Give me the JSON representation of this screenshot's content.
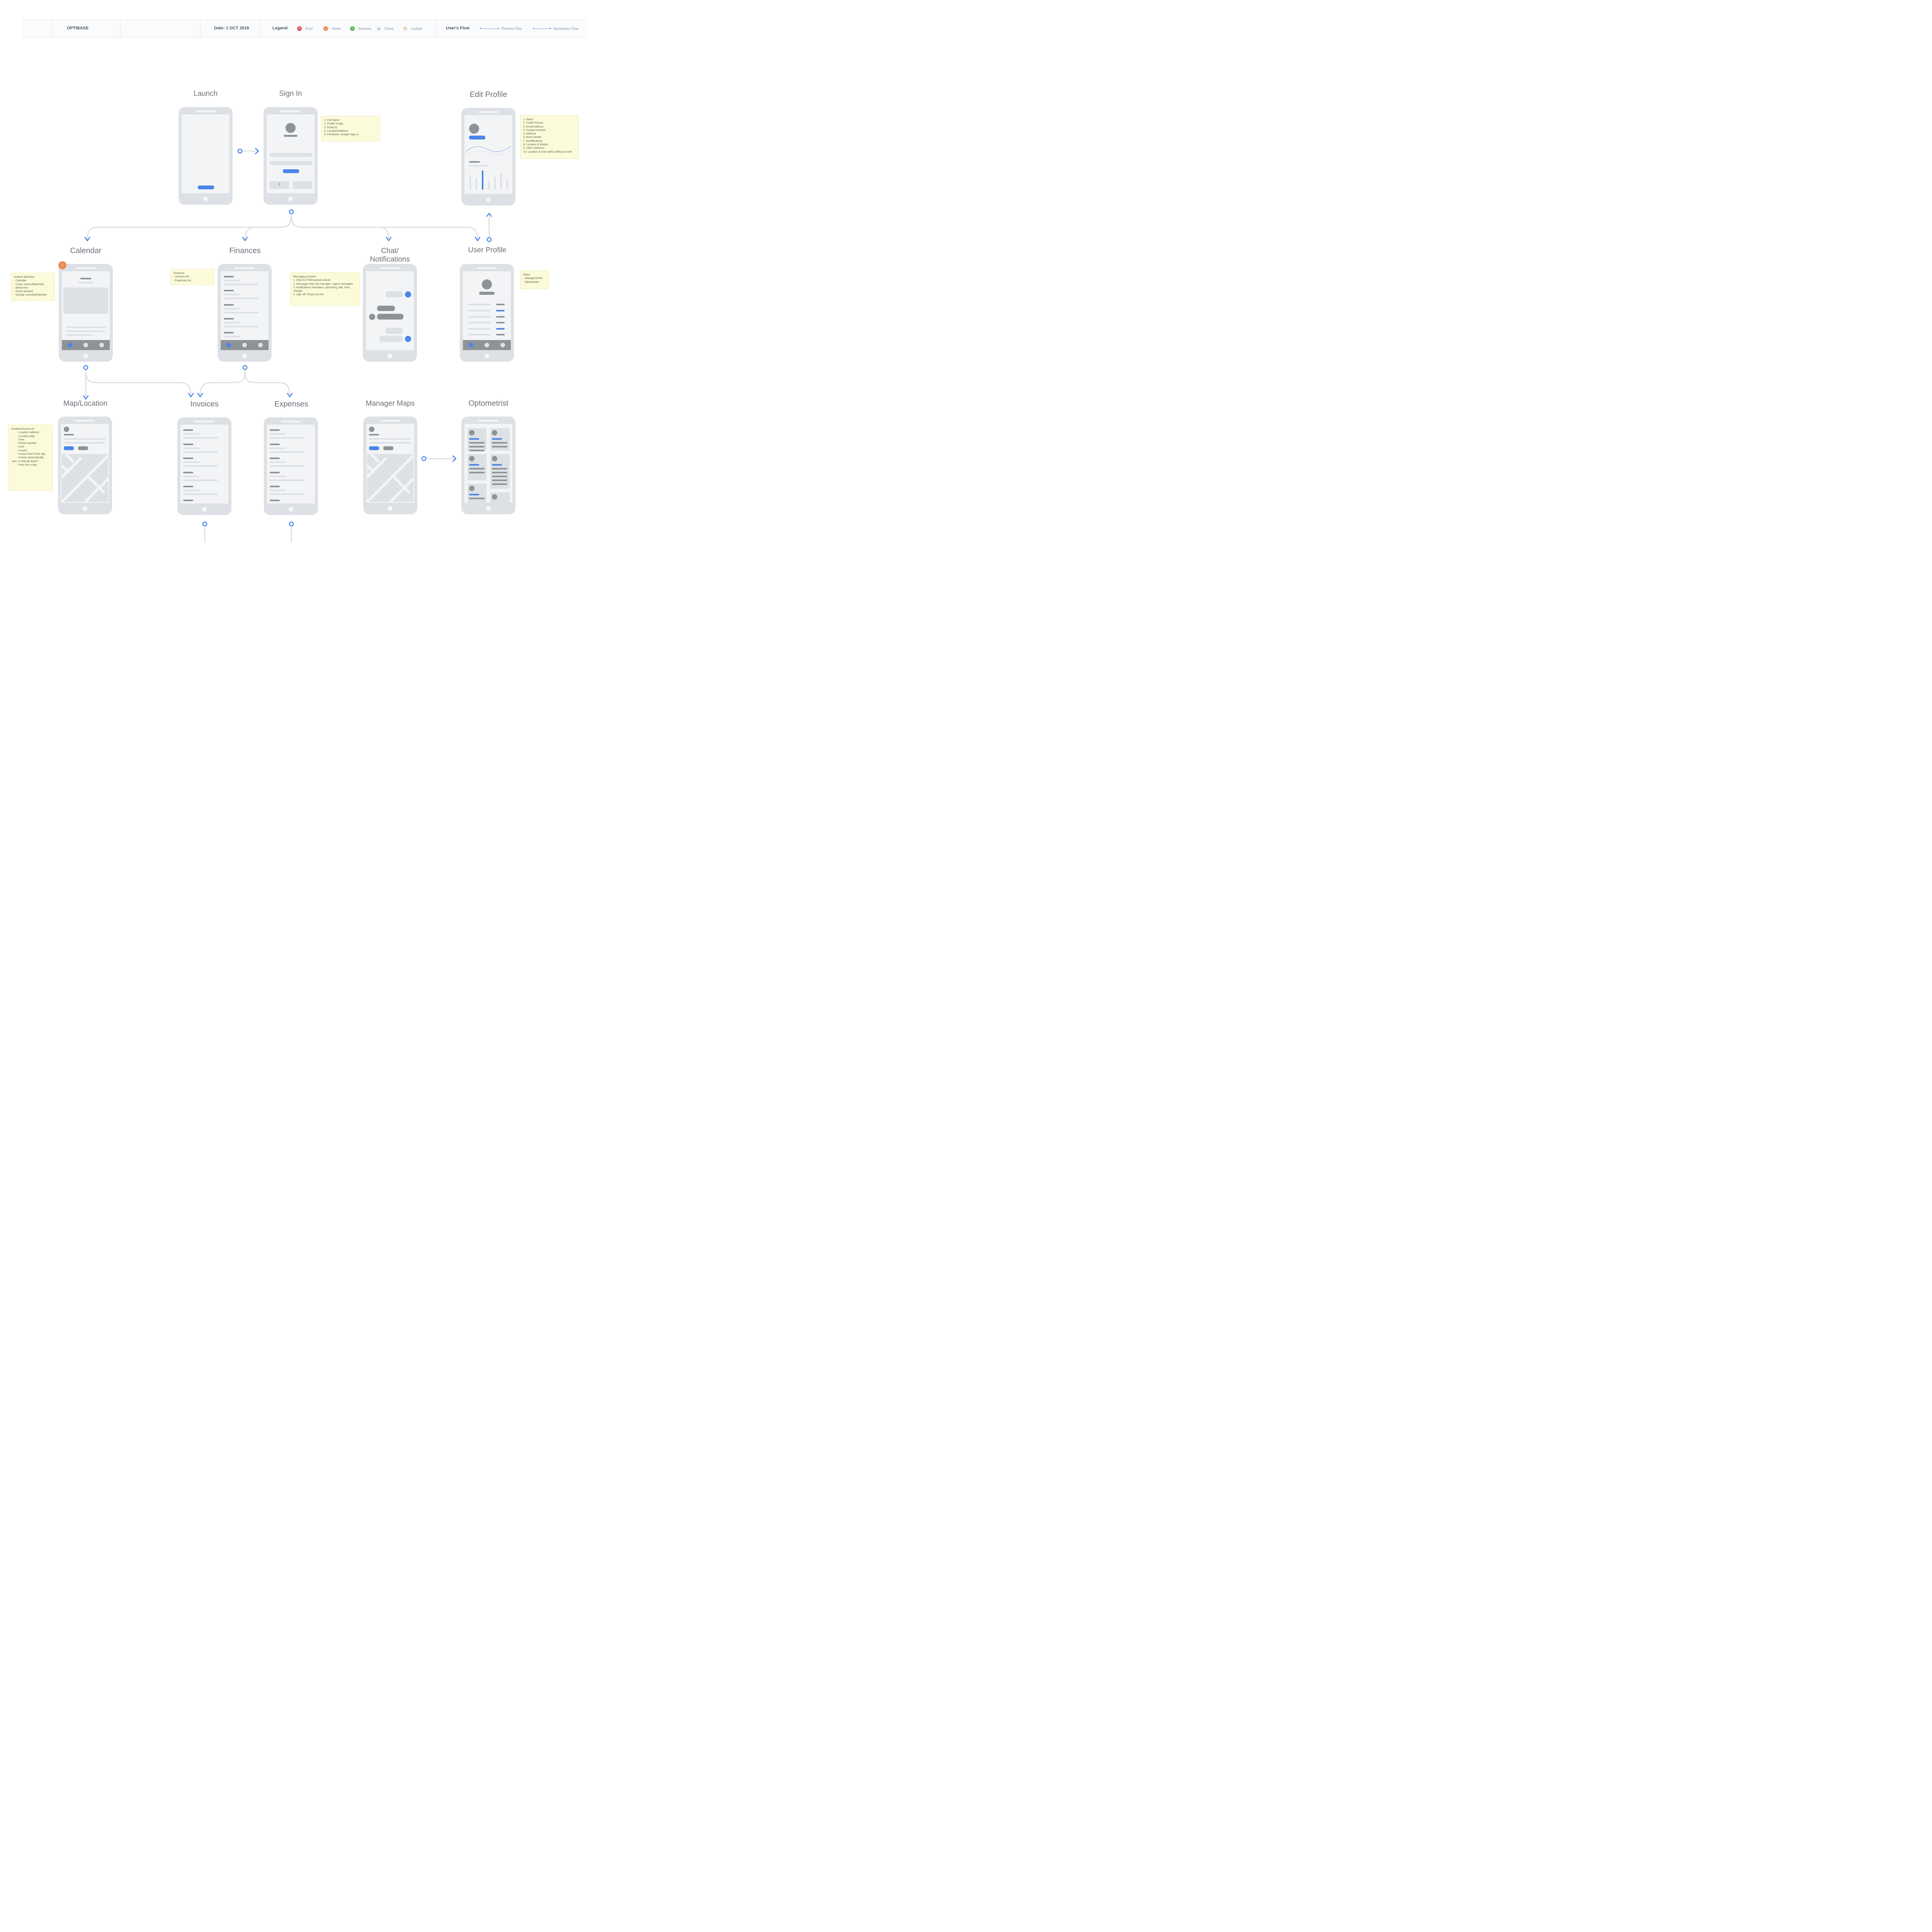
{
  "header": {
    "app_name": "OPTIBASE",
    "date": "Date: 1 OCT  2018",
    "legend_label": "Legend",
    "legend": [
      {
        "label": "Error",
        "color": "#e04b5f",
        "icon": "error-icon",
        "glyph": "✕"
      },
      {
        "label": "Home",
        "color": "#ee8a52",
        "icon": "home-icon",
        "glyph": "⌂"
      },
      {
        "label": "Success",
        "color": "#5cb85c",
        "icon": "success-icon",
        "glyph": "✓"
      },
      {
        "label": "Cloud",
        "color": "#4a86e8",
        "icon": "cloud-icon",
        "glyph": "☁"
      },
      {
        "label": "Locked",
        "color": "#e04b5f",
        "icon": "lock-icon",
        "glyph": "🔒"
      }
    ],
    "flow_label": "User's Flow",
    "primary_flow": "Primary Flow",
    "secondary_flow": "Secondary Flow"
  },
  "screens": {
    "launch": "Launch",
    "sign_in": "Sign In",
    "edit_profile": "Edit Profile",
    "calendar": "Calendar",
    "finances": "Finances",
    "chat_line1": "Chat/",
    "chat_line2": "Notifications",
    "user_profile": "User Profile",
    "map_location": "Map/Location",
    "invoices": "Invoices",
    "expenses": "Expenses",
    "manager_maps": "Manager Maps",
    "optometrist": "Optometrist"
  },
  "notes": {
    "sign_in": "1. Full Name\n2. Profile Image\n3. Email ID\n4. Location/Address\n5. Facebook, Google Sign in",
    "edit_profile": "1. Name\n2. Profile Picture\n3. Email Address\n4. Contact Number\n5. Address\n6. Bank Details\n7. Qualifications\n8. Location & Radius\n9. Clinic Selection\n10. Location & max radius willing to work",
    "calendar": "Default Tab/View.\n- Calendar\n- Colors Green/Red/Yello\n- White free\n- Green booked\n- Orange canceled/rejected",
    "finances": "Finances\n- Invoices list\n- Expenses list",
    "chat": "Messaging System\n1. Only for Professional notices\n2. Messages from the manager, urgent messages\n3. Notifications reminders, upcoming, late, time\nchange.\n4. Sign off, Thank you etc",
    "user_profile": "Roles\n- Manager/Clinic\n- Optometrist",
    "map_location": "location/invoice etc\n       - Location Address\n       - Location Map\n       - Time\n       - Phone Number\n       - Cost\n       - Invoice\n       - Invoice End of the day.\n       - Invoice automatically\nsent. Is that job done?\n       - Only one a day."
  },
  "sign_in_facebook_glyph": "f",
  "colors": {
    "accent": "#4a86e8",
    "phone": "#dde1e5",
    "screen": "#f3f4f6",
    "note": "#fcfbd9",
    "home_badge": "#ee8a52"
  }
}
